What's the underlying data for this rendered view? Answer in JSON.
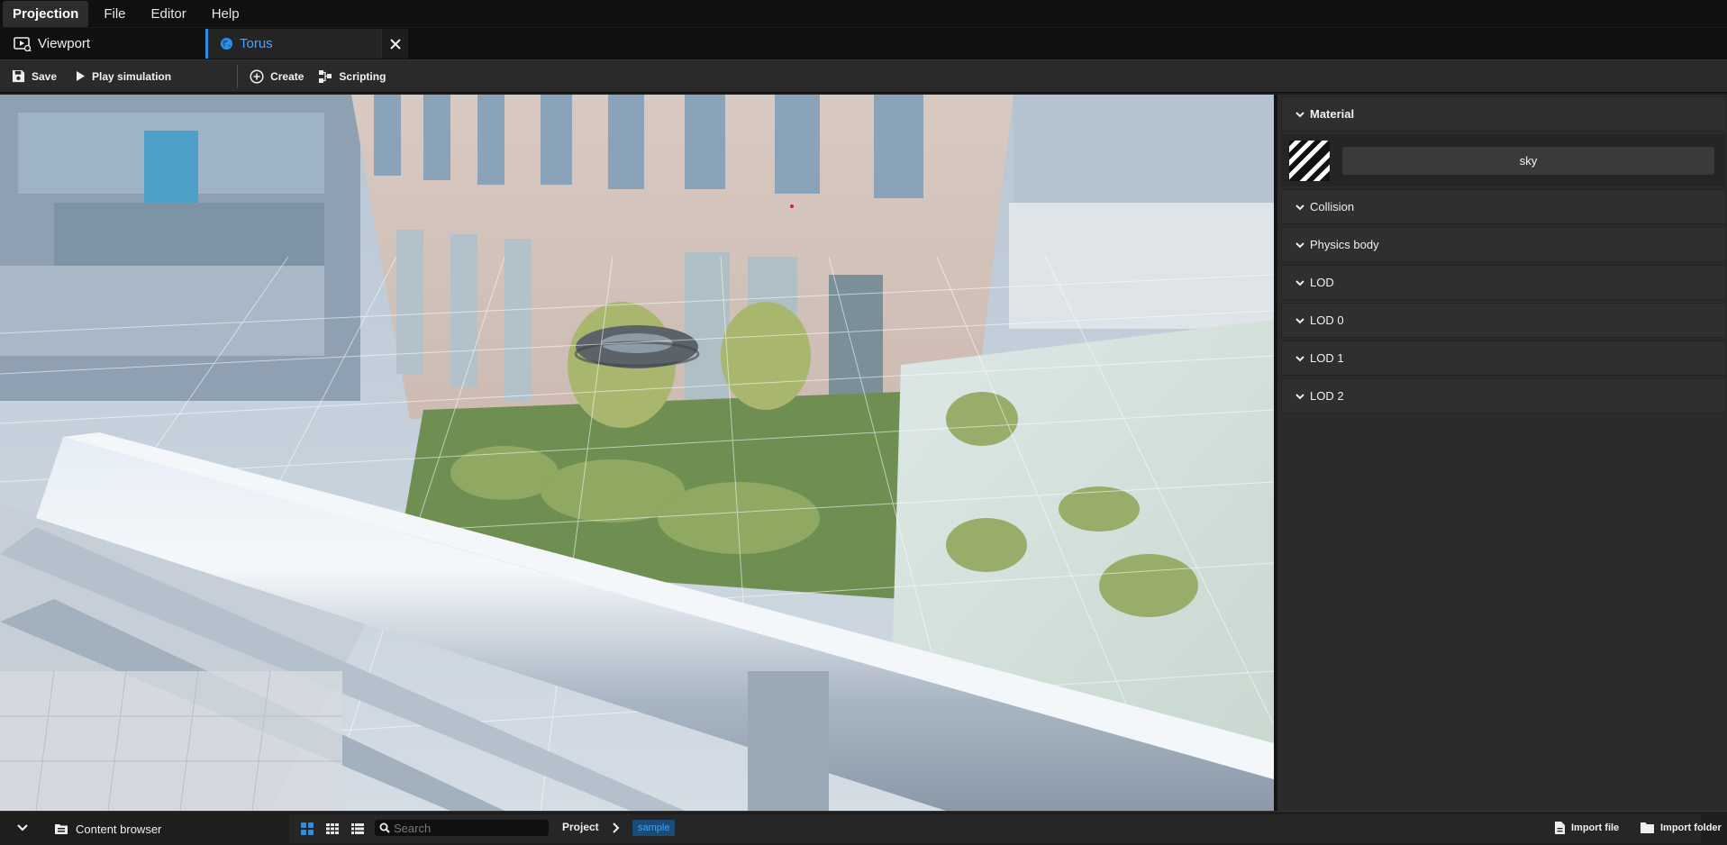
{
  "menubar": {
    "items": [
      {
        "label": "Projection",
        "active": true
      },
      {
        "label": "File",
        "active": false
      },
      {
        "label": "Editor",
        "active": false
      },
      {
        "label": "Help",
        "active": false
      }
    ]
  },
  "tabs": {
    "viewport_label": "Viewport",
    "document_label": "Torus",
    "document_icon": "globe-icon",
    "accent_color": "#2b8fe8"
  },
  "toolbar": {
    "save_label": "Save",
    "play_label": "Play simulation",
    "create_label": "Create",
    "scripting_label": "Scripting"
  },
  "viewport": {
    "scene_description_icon": "3d-viewport",
    "object": "torus"
  },
  "panel": {
    "material_header": "Material",
    "material_name": "sky",
    "sections": [
      "Collision",
      "Physics body",
      "LOD",
      "LOD 0",
      "LOD 1",
      "LOD 2"
    ]
  },
  "bottombar": {
    "content_browser_label": "Content browser",
    "search_placeholder": "Search",
    "breadcrumb_project": "Project",
    "breadcrumb_current": "sample",
    "import_file_label": "Import file",
    "import_folder_label": "Import folder",
    "active_view_mode": "grid-large"
  }
}
